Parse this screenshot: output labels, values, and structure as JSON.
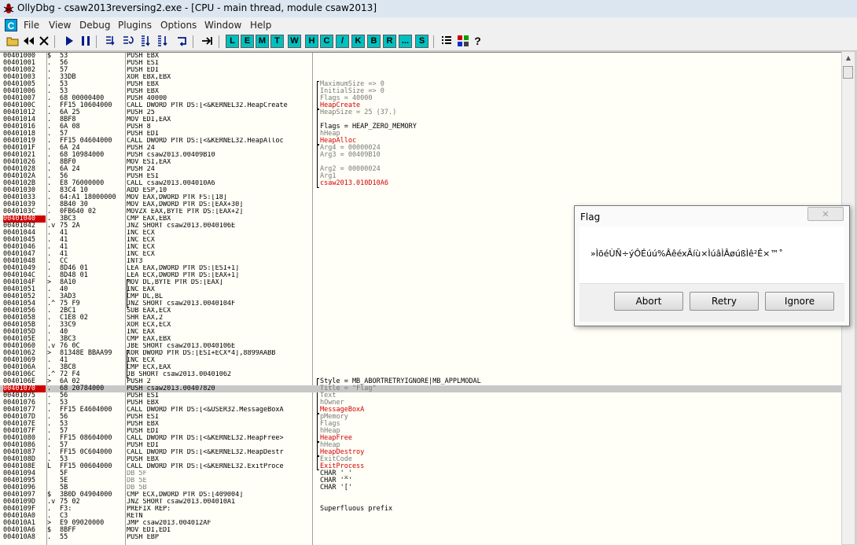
{
  "window": {
    "title": "OllyDbg - csaw2013reversing2.exe - [CPU - main thread, module csaw2013]"
  },
  "menu": [
    "File",
    "View",
    "Debug",
    "Plugins",
    "Options",
    "Window",
    "Help"
  ],
  "menu_c_label": "C",
  "toolbar_letters": [
    "L",
    "E",
    "M",
    "T",
    "W",
    "H",
    "C",
    "/",
    "K",
    "B",
    "R",
    "...",
    "S"
  ],
  "toolbar_icons": [
    "open-icon",
    "restart-icon",
    "close-icon",
    "run-icon",
    "pause-icon",
    "step-into-icon",
    "step-over-icon",
    "trace-into-icon",
    "trace-over-icon",
    "execute-till-return-icon",
    "goto-icon",
    "appearance-icon",
    "colors-icon",
    "help-icon"
  ],
  "colors": {
    "breakpoint": "#d00000",
    "api_call_comment": "#d00000",
    "selected_row": "#c8c8c8",
    "pane_background": "#fffff7",
    "letter_button": "#00c0c0"
  },
  "rows": [
    {
      "addr": "00401000",
      "mark": "$",
      "hex": "53",
      "dis": "PUSH EBX",
      "com": ""
    },
    {
      "addr": "00401001",
      "mark": ".",
      "hex": "56",
      "dis": "PUSH ESI",
      "com": ""
    },
    {
      "addr": "00401002",
      "mark": ".",
      "hex": "57",
      "dis": "PUSH EDI",
      "com": ""
    },
    {
      "addr": "00401003",
      "mark": ".",
      "hex": "33DB",
      "dis": "XOR EBX,EBX",
      "com": ""
    },
    {
      "addr": "00401005",
      "mark": ".",
      "hex": "53",
      "dis": "PUSH EBX",
      "com": "MaximumSize => 0",
      "cc": "gray"
    },
    {
      "addr": "00401006",
      "mark": ".",
      "hex": "53",
      "dis": "PUSH EBX",
      "com": "InitialSize => 0",
      "cc": "gray"
    },
    {
      "addr": "00401007",
      "mark": ".",
      "hex": "68 00000400",
      "dis": "PUSH 40000",
      "com": "Flags = 40000",
      "cc": "gray"
    },
    {
      "addr": "0040100C",
      "mark": ".",
      "hex": "FF15 10604000",
      "dis": "CALL DWORD PTR DS:[<&KERNEL32.HeapCreate",
      "com": "HeapCreate",
      "cc": "red"
    },
    {
      "addr": "00401012",
      "mark": ".",
      "hex": "6A 25",
      "dis": "PUSH 25",
      "com": "HeapSize = 25 (37.)",
      "cc": "gray"
    },
    {
      "addr": "00401014",
      "mark": ".",
      "hex": "8BF8",
      "dis": "MOV EDI,EAX",
      "com": ""
    },
    {
      "addr": "00401016",
      "mark": ".",
      "hex": "6A 08",
      "dis": "PUSH 8",
      "com": "Flags = HEAP_ZERO_MEMORY",
      "cc": "black"
    },
    {
      "addr": "00401018",
      "mark": ".",
      "hex": "57",
      "dis": "PUSH EDI",
      "com": "hHeap",
      "cc": "gray"
    },
    {
      "addr": "00401019",
      "mark": ".",
      "hex": "FF15 04604000",
      "dis": "CALL DWORD PTR DS:[<&KERNEL32.HeapAlloc",
      "com": "HeapAlloc",
      "cc": "red"
    },
    {
      "addr": "0040101F",
      "mark": ".",
      "hex": "6A 24",
      "dis": "PUSH 24",
      "com": "Arg4 = 00000024",
      "cc": "gray"
    },
    {
      "addr": "00401021",
      "mark": ".",
      "hex": "68 10984000",
      "dis": "PUSH csaw2013.00409B10",
      "com": "Arg3 = 00409B10",
      "cc": "gray"
    },
    {
      "addr": "00401026",
      "mark": ".",
      "hex": "8BF0",
      "dis": "MOV ESI,EAX",
      "com": ""
    },
    {
      "addr": "00401028",
      "mark": ".",
      "hex": "6A 24",
      "dis": "PUSH 24",
      "com": "Arg2 = 00000024",
      "cc": "gray"
    },
    {
      "addr": "0040102A",
      "mark": ".",
      "hex": "56",
      "dis": "PUSH ESI",
      "com": "Arg1",
      "cc": "gray"
    },
    {
      "addr": "0040102B",
      "mark": ".",
      "hex": "E8 76000000",
      "dis": "CALL csaw2013.004010A6",
      "com": "csaw2013.010D10A6",
      "cc": "red"
    },
    {
      "addr": "00401030",
      "mark": ".",
      "hex": "83C4 10",
      "dis": "ADD ESP,10",
      "com": ""
    },
    {
      "addr": "00401033",
      "mark": ".",
      "hex": "64:A1 18000000",
      "dis": "MOV EAX,DWORD PTR FS:[18]",
      "com": ""
    },
    {
      "addr": "00401039",
      "mark": ".",
      "hex": "8B40 30",
      "dis": "MOV EAX,DWORD PTR DS:[EAX+30]",
      "com": ""
    },
    {
      "addr": "0040103C",
      "mark": ".",
      "hex": "0FB640 02",
      "dis": "MOVZX EAX,BYTE PTR DS:[EAX+2]",
      "com": ""
    },
    {
      "addr": "00401040",
      "mark": ".",
      "hex": "3BC3",
      "dis": "CMP EAX,EBX",
      "com": "",
      "bp": true
    },
    {
      "addr": "00401042",
      "mark": ".v",
      "hex": "75 2A",
      "dis": "JNZ SHORT csaw2013.0040106E",
      "com": ""
    },
    {
      "addr": "00401044",
      "mark": ".",
      "hex": "41",
      "dis": "INC ECX",
      "com": ""
    },
    {
      "addr": "00401045",
      "mark": ".",
      "hex": "41",
      "dis": "INC ECX",
      "com": ""
    },
    {
      "addr": "00401046",
      "mark": ".",
      "hex": "41",
      "dis": "INC ECX",
      "com": ""
    },
    {
      "addr": "00401047",
      "mark": ".",
      "hex": "41",
      "dis": "INC ECX",
      "com": ""
    },
    {
      "addr": "00401048",
      "mark": ".",
      "hex": "CC",
      "dis": "INT3",
      "com": ""
    },
    {
      "addr": "00401049",
      "mark": ".",
      "hex": "8D46 01",
      "dis": "LEA EAX,DWORD PTR DS:[ESI+1]",
      "com": ""
    },
    {
      "addr": "0040104C",
      "mark": ".",
      "hex": "8D48 01",
      "dis": "LEA ECX,DWORD PTR DS:[EAX+1]",
      "com": ""
    },
    {
      "addr": "0040104F",
      "mark": ">",
      "hex": "8A10",
      "dis": "MOV DL,BYTE PTR DS:[EAX]",
      "com": ""
    },
    {
      "addr": "00401051",
      "mark": ".",
      "hex": "40",
      "dis": "INC EAX",
      "com": ""
    },
    {
      "addr": "00401052",
      "mark": ".",
      "hex": "3AD3",
      "dis": "CMP DL,BL",
      "com": ""
    },
    {
      "addr": "00401054",
      "mark": ".^",
      "hex": "75 F9",
      "dis": "JNZ SHORT csaw2013.0040104F",
      "com": ""
    },
    {
      "addr": "00401056",
      "mark": ".",
      "hex": "2BC1",
      "dis": "SUB EAX,ECX",
      "com": ""
    },
    {
      "addr": "00401058",
      "mark": ".",
      "hex": "C1E8 02",
      "dis": "SHR EAX,2",
      "com": ""
    },
    {
      "addr": "0040105B",
      "mark": ".",
      "hex": "33C9",
      "dis": "XOR ECX,ECX",
      "com": ""
    },
    {
      "addr": "0040105D",
      "mark": ".",
      "hex": "40",
      "dis": "INC EAX",
      "com": ""
    },
    {
      "addr": "0040105E",
      "mark": ".",
      "hex": "3BC3",
      "dis": "CMP EAX,EBX",
      "com": ""
    },
    {
      "addr": "00401060",
      "mark": ".v",
      "hex": "76 0C",
      "dis": "JBE SHORT csaw2013.0040106E",
      "com": ""
    },
    {
      "addr": "00401062",
      "mark": ">",
      "hex": "81348E BBAA99",
      "dis": "XOR DWORD PTR DS:[ESI+ECX*4],8899AABB",
      "com": ""
    },
    {
      "addr": "00401069",
      "mark": ".",
      "hex": "41",
      "dis": "INC ECX",
      "com": ""
    },
    {
      "addr": "0040106A",
      "mark": ".",
      "hex": "3BC8",
      "dis": "CMP ECX,EAX",
      "com": ""
    },
    {
      "addr": "0040106C",
      "mark": ".^",
      "hex": "72 F4",
      "dis": "JB SHORT csaw2013.00401062",
      "com": ""
    },
    {
      "addr": "0040106E",
      "mark": ">",
      "hex": "6A 02",
      "dis": "PUSH 2",
      "com": "Style = MB_ABORTRETRYIGNORE|MB_APPLMODAL",
      "cc": "black"
    },
    {
      "addr": "00401070",
      "mark": ".",
      "hex": "68 20784000",
      "dis": "PUSH csaw2013.00407820",
      "com": "Title = \"Flag\"",
      "cc": "gray",
      "bp": true,
      "hl": true
    },
    {
      "addr": "00401075",
      "mark": ".",
      "hex": "56",
      "dis": "PUSH ESI",
      "com": "Text",
      "cc": "gray"
    },
    {
      "addr": "00401076",
      "mark": ".",
      "hex": "53",
      "dis": "PUSH EBX",
      "com": "hOwner",
      "cc": "gray"
    },
    {
      "addr": "00401077",
      "mark": ".",
      "hex": "FF15 E4604000",
      "dis": "CALL DWORD PTR DS:[<&USER32.MessageBoxA",
      "com": "MessageBoxA",
      "cc": "red"
    },
    {
      "addr": "0040107D",
      "mark": ".",
      "hex": "56",
      "dis": "PUSH ESI",
      "com": "pMemory",
      "cc": "gray"
    },
    {
      "addr": "0040107E",
      "mark": ".",
      "hex": "53",
      "dis": "PUSH EBX",
      "com": "Flags",
      "cc": "gray"
    },
    {
      "addr": "0040107F",
      "mark": ".",
      "hex": "57",
      "dis": "PUSH EDI",
      "com": "hHeap",
      "cc": "gray"
    },
    {
      "addr": "00401080",
      "mark": ".",
      "hex": "FF15 08604000",
      "dis": "CALL DWORD PTR DS:[<&KERNEL32.HeapFree>",
      "com": "HeapFree",
      "cc": "red"
    },
    {
      "addr": "00401086",
      "mark": ".",
      "hex": "57",
      "dis": "PUSH EDI",
      "com": "hHeap",
      "cc": "gray"
    },
    {
      "addr": "00401087",
      "mark": ".",
      "hex": "FF15 0C604000",
      "dis": "CALL DWORD PTR DS:[<&KERNEL32.HeapDestr",
      "com": "HeapDestroy",
      "cc": "red"
    },
    {
      "addr": "0040108D",
      "mark": ".",
      "hex": "53",
      "dis": "PUSH EBX",
      "com": "ExitCode",
      "cc": "gray"
    },
    {
      "addr": "0040108E",
      "mark": "L",
      "hex": "FF15 00604000",
      "dis": "CALL DWORD PTR DS:[<&KERNEL32.ExitProce",
      "com": "ExitProcess",
      "cc": "red"
    },
    {
      "addr": "00401094",
      "mark": "",
      "hex": "5F",
      "dis": "DB 5F",
      "com": "CHAR '_'",
      "cc": "black",
      "dg": true
    },
    {
      "addr": "00401095",
      "mark": "",
      "hex": "5E",
      "dis": "DB 5E",
      "com": "CHAR '^'",
      "cc": "black",
      "dg": true
    },
    {
      "addr": "00401096",
      "mark": "",
      "hex": "5B",
      "dis": "DB 5B",
      "com": "CHAR '['",
      "cc": "black",
      "dg": true
    },
    {
      "addr": "00401097",
      "mark": "$",
      "hex": "3B0D 04904000",
      "dis": "CMP ECX,DWORD PTR DS:[409004]",
      "com": ""
    },
    {
      "addr": "0040109D",
      "mark": ".v",
      "hex": "75 02",
      "dis": "JNZ SHORT csaw2013.004010A1",
      "com": ""
    },
    {
      "addr": "0040109F",
      "mark": ".",
      "hex": "F3:",
      "dis": "PREFIX REP:",
      "com": "Superfluous prefix",
      "cc": "black"
    },
    {
      "addr": "004010A0",
      "mark": ".",
      "hex": "C3",
      "dis": "RETN",
      "com": ""
    },
    {
      "addr": "004010A1",
      "mark": ">",
      "hex": "E9 09020000",
      "dis": "JMP csaw2013.004012AF",
      "com": ""
    },
    {
      "addr": "004010A6",
      "mark": "$",
      "hex": "8BFF",
      "dis": "MOV EDI,EDI",
      "com": ""
    },
    {
      "addr": "004010A8",
      "mark": ".",
      "hex": "55",
      "dis": "PUSH EBP",
      "com": ""
    }
  ],
  "dialog": {
    "title": "Flag",
    "close_glyph": "✕",
    "message": "»ÌõéÙÑ÷ýÔÉúú%ÂêéxÃíù×ÌúâÌÂøúßÌê²Ê×™˚",
    "buttons": [
      "Abort",
      "Retry",
      "Ignore"
    ]
  }
}
